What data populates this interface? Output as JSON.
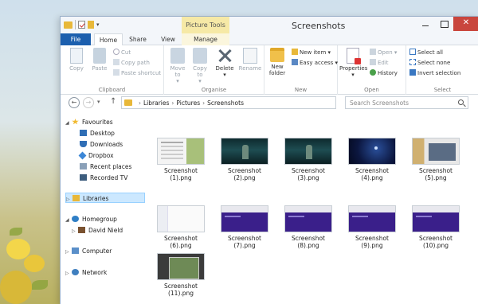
{
  "window": {
    "title": "Screenshots",
    "context_tab_group": "Picture Tools",
    "close_glyph": "✕"
  },
  "tabs": [
    "File",
    "Home",
    "Share",
    "View",
    "Manage"
  ],
  "ribbon": {
    "clipboard": {
      "label": "Clipboard",
      "copy": "Copy",
      "paste": "Paste",
      "cut": "Cut",
      "copy_path": "Copy path",
      "paste_shortcut": "Paste shortcut"
    },
    "organise": {
      "label": "Organise",
      "move_to": "Move to",
      "copy_to": "Copy to",
      "delete": "Delete",
      "rename": "Rename"
    },
    "new": {
      "label": "New",
      "new_folder": "New folder",
      "new_item": "New item",
      "easy_access": "Easy access"
    },
    "open": {
      "label": "Open",
      "properties": "Properties",
      "open": "Open",
      "edit": "Edit",
      "history": "History"
    },
    "select": {
      "label": "Select",
      "select_all": "Select all",
      "select_none": "Select none",
      "invert_selection": "Invert selection"
    }
  },
  "address": {
    "crumbs": [
      "Libraries",
      "Pictures",
      "Screenshots"
    ],
    "search_placeholder": "Search Screenshots"
  },
  "nav": {
    "favourites": "Favourites",
    "desktop": "Desktop",
    "downloads": "Downloads",
    "dropbox": "Dropbox",
    "recent_places": "Recent places",
    "recorded_tv": "Recorded TV",
    "libraries": "Libraries",
    "homegroup": "Homegroup",
    "user": "David Nield",
    "computer": "Computer",
    "network": "Network"
  },
  "files": [
    {
      "line1": "Screenshot",
      "line2": "(1).png",
      "thumb": "desktop"
    },
    {
      "line1": "Screenshot",
      "line2": "(2).png",
      "thumb": "video"
    },
    {
      "line1": "Screenshot",
      "line2": "(3).png",
      "thumb": "video"
    },
    {
      "line1": "Screenshot",
      "line2": "(4).png",
      "thumb": "space"
    },
    {
      "line1": "Screenshot",
      "line2": "(5).png",
      "thumb": "apps"
    },
    {
      "line1": "Screenshot",
      "line2": "(6).png",
      "thumb": "white"
    },
    {
      "line1": "Screenshot",
      "line2": "(7).png",
      "thumb": "purple"
    },
    {
      "line1": "Screenshot",
      "line2": "(8).png",
      "thumb": "purple"
    },
    {
      "line1": "Screenshot",
      "line2": "(9).png",
      "thumb": "purple"
    },
    {
      "line1": "Screenshot",
      "line2": "(10).png",
      "thumb": "purple"
    },
    {
      "line1": "Screenshot",
      "line2": "(11).png",
      "thumb": "dark"
    }
  ],
  "colors": {
    "file_tab": "#1c5fae",
    "picture_tools": "#f6e9a6",
    "close_button": "#c9463d",
    "selection": "#cce8ff"
  }
}
